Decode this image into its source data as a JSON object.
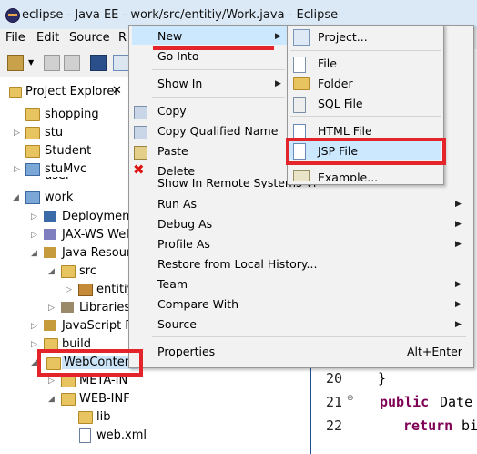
{
  "window": {
    "title": "eclipse - Java EE - work/src/entitiy/Work.java - Eclipse"
  },
  "menubar": [
    "File",
    "Edit",
    "Source",
    "R"
  ],
  "explorer": {
    "title": "Project Explorer",
    "tab_suffix": "✕",
    "items": [
      {
        "label": "shopping"
      },
      {
        "label": "stu"
      },
      {
        "label": "Student"
      },
      {
        "label": "stuMvc"
      },
      {
        "label": "user"
      },
      {
        "label": "work"
      },
      {
        "label": "Deployment"
      },
      {
        "label": "JAX-WS Wel"
      },
      {
        "label": "Java Resour"
      },
      {
        "label": "src"
      },
      {
        "label": "entitiy"
      },
      {
        "label": "Libraries"
      },
      {
        "label": "JavaScript R"
      },
      {
        "label": "build"
      },
      {
        "label": "WebContent"
      },
      {
        "label": "META-INF"
      },
      {
        "label": "WEB-INF"
      },
      {
        "label": "lib"
      },
      {
        "label": "web.xml"
      }
    ]
  },
  "context_menu": {
    "items": [
      {
        "label": "New"
      },
      {
        "label": "Go Into"
      },
      {
        "label": "Show In"
      },
      {
        "label": "Copy"
      },
      {
        "label": "Copy Qualified Name"
      },
      {
        "label": "Paste"
      },
      {
        "label": "Delete"
      },
      {
        "label": "Show In Remote Systems View"
      },
      {
        "label": "Run As"
      },
      {
        "label": "Debug As"
      },
      {
        "label": "Profile As"
      },
      {
        "label": "Restore from Local History..."
      },
      {
        "label": "Team"
      },
      {
        "label": "Compare With"
      },
      {
        "label": "Source"
      },
      {
        "label": "Properties",
        "shortcut": "Alt+Enter"
      }
    ]
  },
  "new_submenu": {
    "items": [
      {
        "label": "Project..."
      },
      {
        "label": "File"
      },
      {
        "label": "Folder"
      },
      {
        "label": "SQL File"
      },
      {
        "label": "HTML File"
      },
      {
        "label": "JSP File"
      },
      {
        "label": "Example..."
      }
    ]
  },
  "editor": {
    "right_letters": [
      "N",
      "C",
      "V",
      "te"
    ],
    "lines": [
      {
        "num": "20",
        "text": "}"
      },
      {
        "num": "21",
        "kw": "public",
        "text": "Date"
      },
      {
        "num": "22",
        "kw": "return",
        "text": "bi"
      }
    ]
  },
  "colors": {
    "highlight_red": "#e3242b",
    "keyword": "#7f0055"
  }
}
